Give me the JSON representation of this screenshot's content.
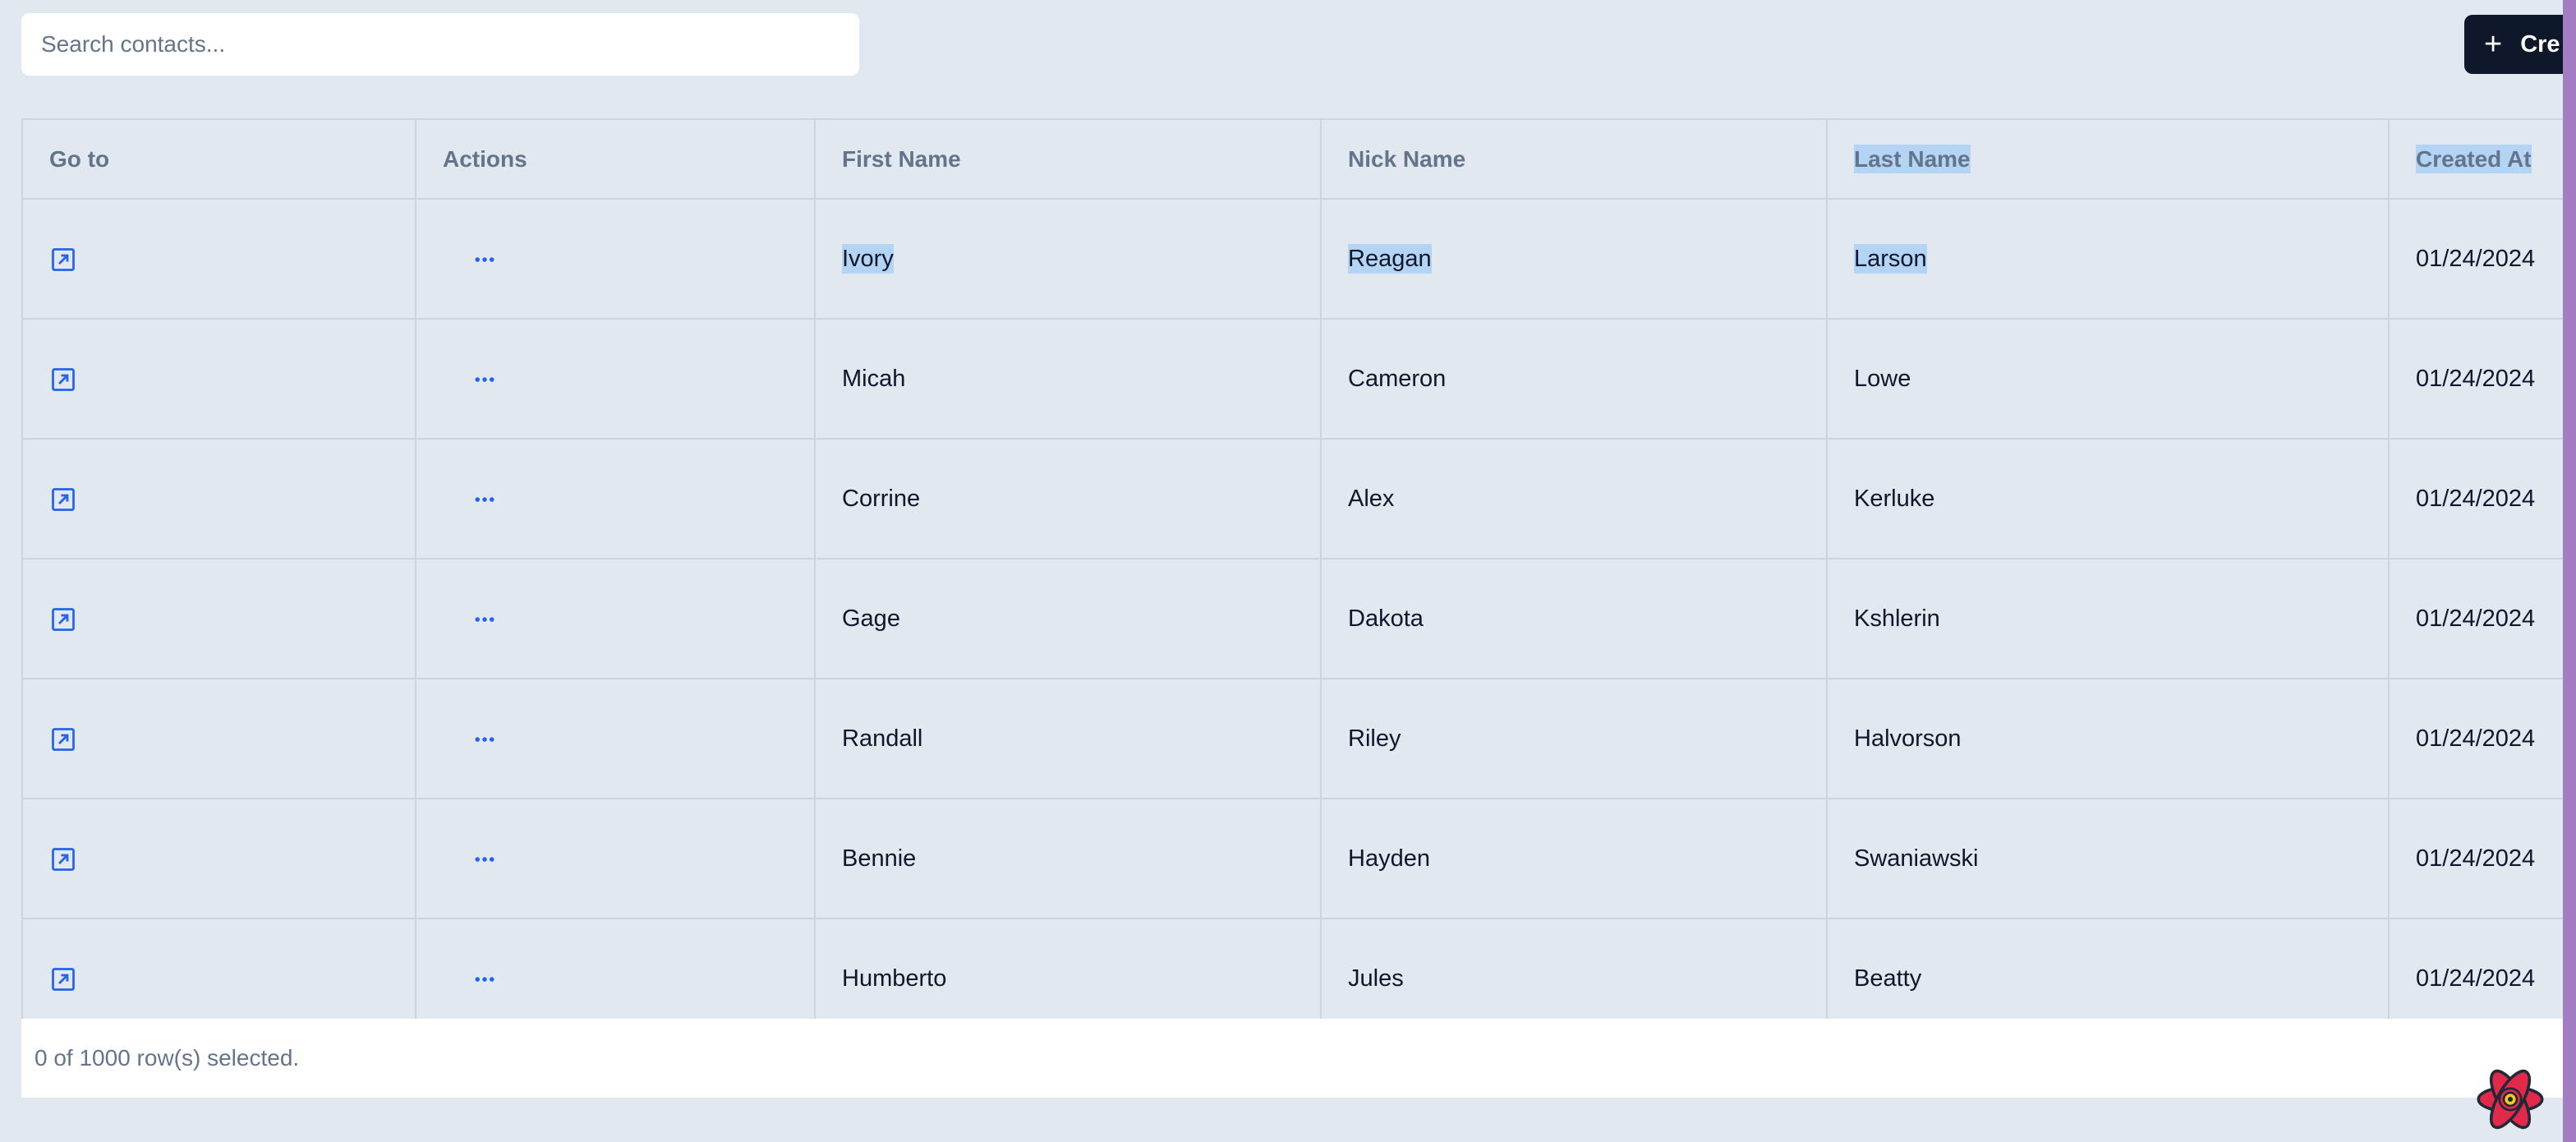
{
  "search": {
    "placeholder": "Search contacts...",
    "value": ""
  },
  "toolbar": {
    "create_label": "Cre",
    "create_icon": "plus-icon"
  },
  "table": {
    "columns": [
      "Go to",
      "Actions",
      "First Name",
      "Nick Name",
      "Last Name",
      "Created At"
    ],
    "rows": [
      {
        "first": "Ivory",
        "nick": "Reagan",
        "last": "Larson",
        "created": "01/24/2024"
      },
      {
        "first": "Micah",
        "nick": "Cameron",
        "last": "Lowe",
        "created": "01/24/2024"
      },
      {
        "first": "Corrine",
        "nick": "Alex",
        "last": "Kerluke",
        "created": "01/24/2024"
      },
      {
        "first": "Gage",
        "nick": "Dakota",
        "last": "Kshlerin",
        "created": "01/24/2024"
      },
      {
        "first": "Randall",
        "nick": "Riley",
        "last": "Halvorson",
        "created": "01/24/2024"
      },
      {
        "first": "Bennie",
        "nick": "Hayden",
        "last": "Swaniawski",
        "created": "01/24/2024"
      },
      {
        "first": "Humberto",
        "nick": "Jules",
        "last": "Beatty",
        "created": "01/24/2024"
      }
    ],
    "row_icons": {
      "goto": "external-link-icon",
      "actions": "more-horizontal-icon"
    }
  },
  "footer": {
    "selection_text": "0 of 1000 row(s) selected."
  },
  "colors": {
    "background": "#e2e8f0",
    "primary_button": "#0f172a",
    "icon_blue": "#2563eb",
    "selection_highlight": "#b3d4f5",
    "scrollbar": "#a47cc1"
  }
}
